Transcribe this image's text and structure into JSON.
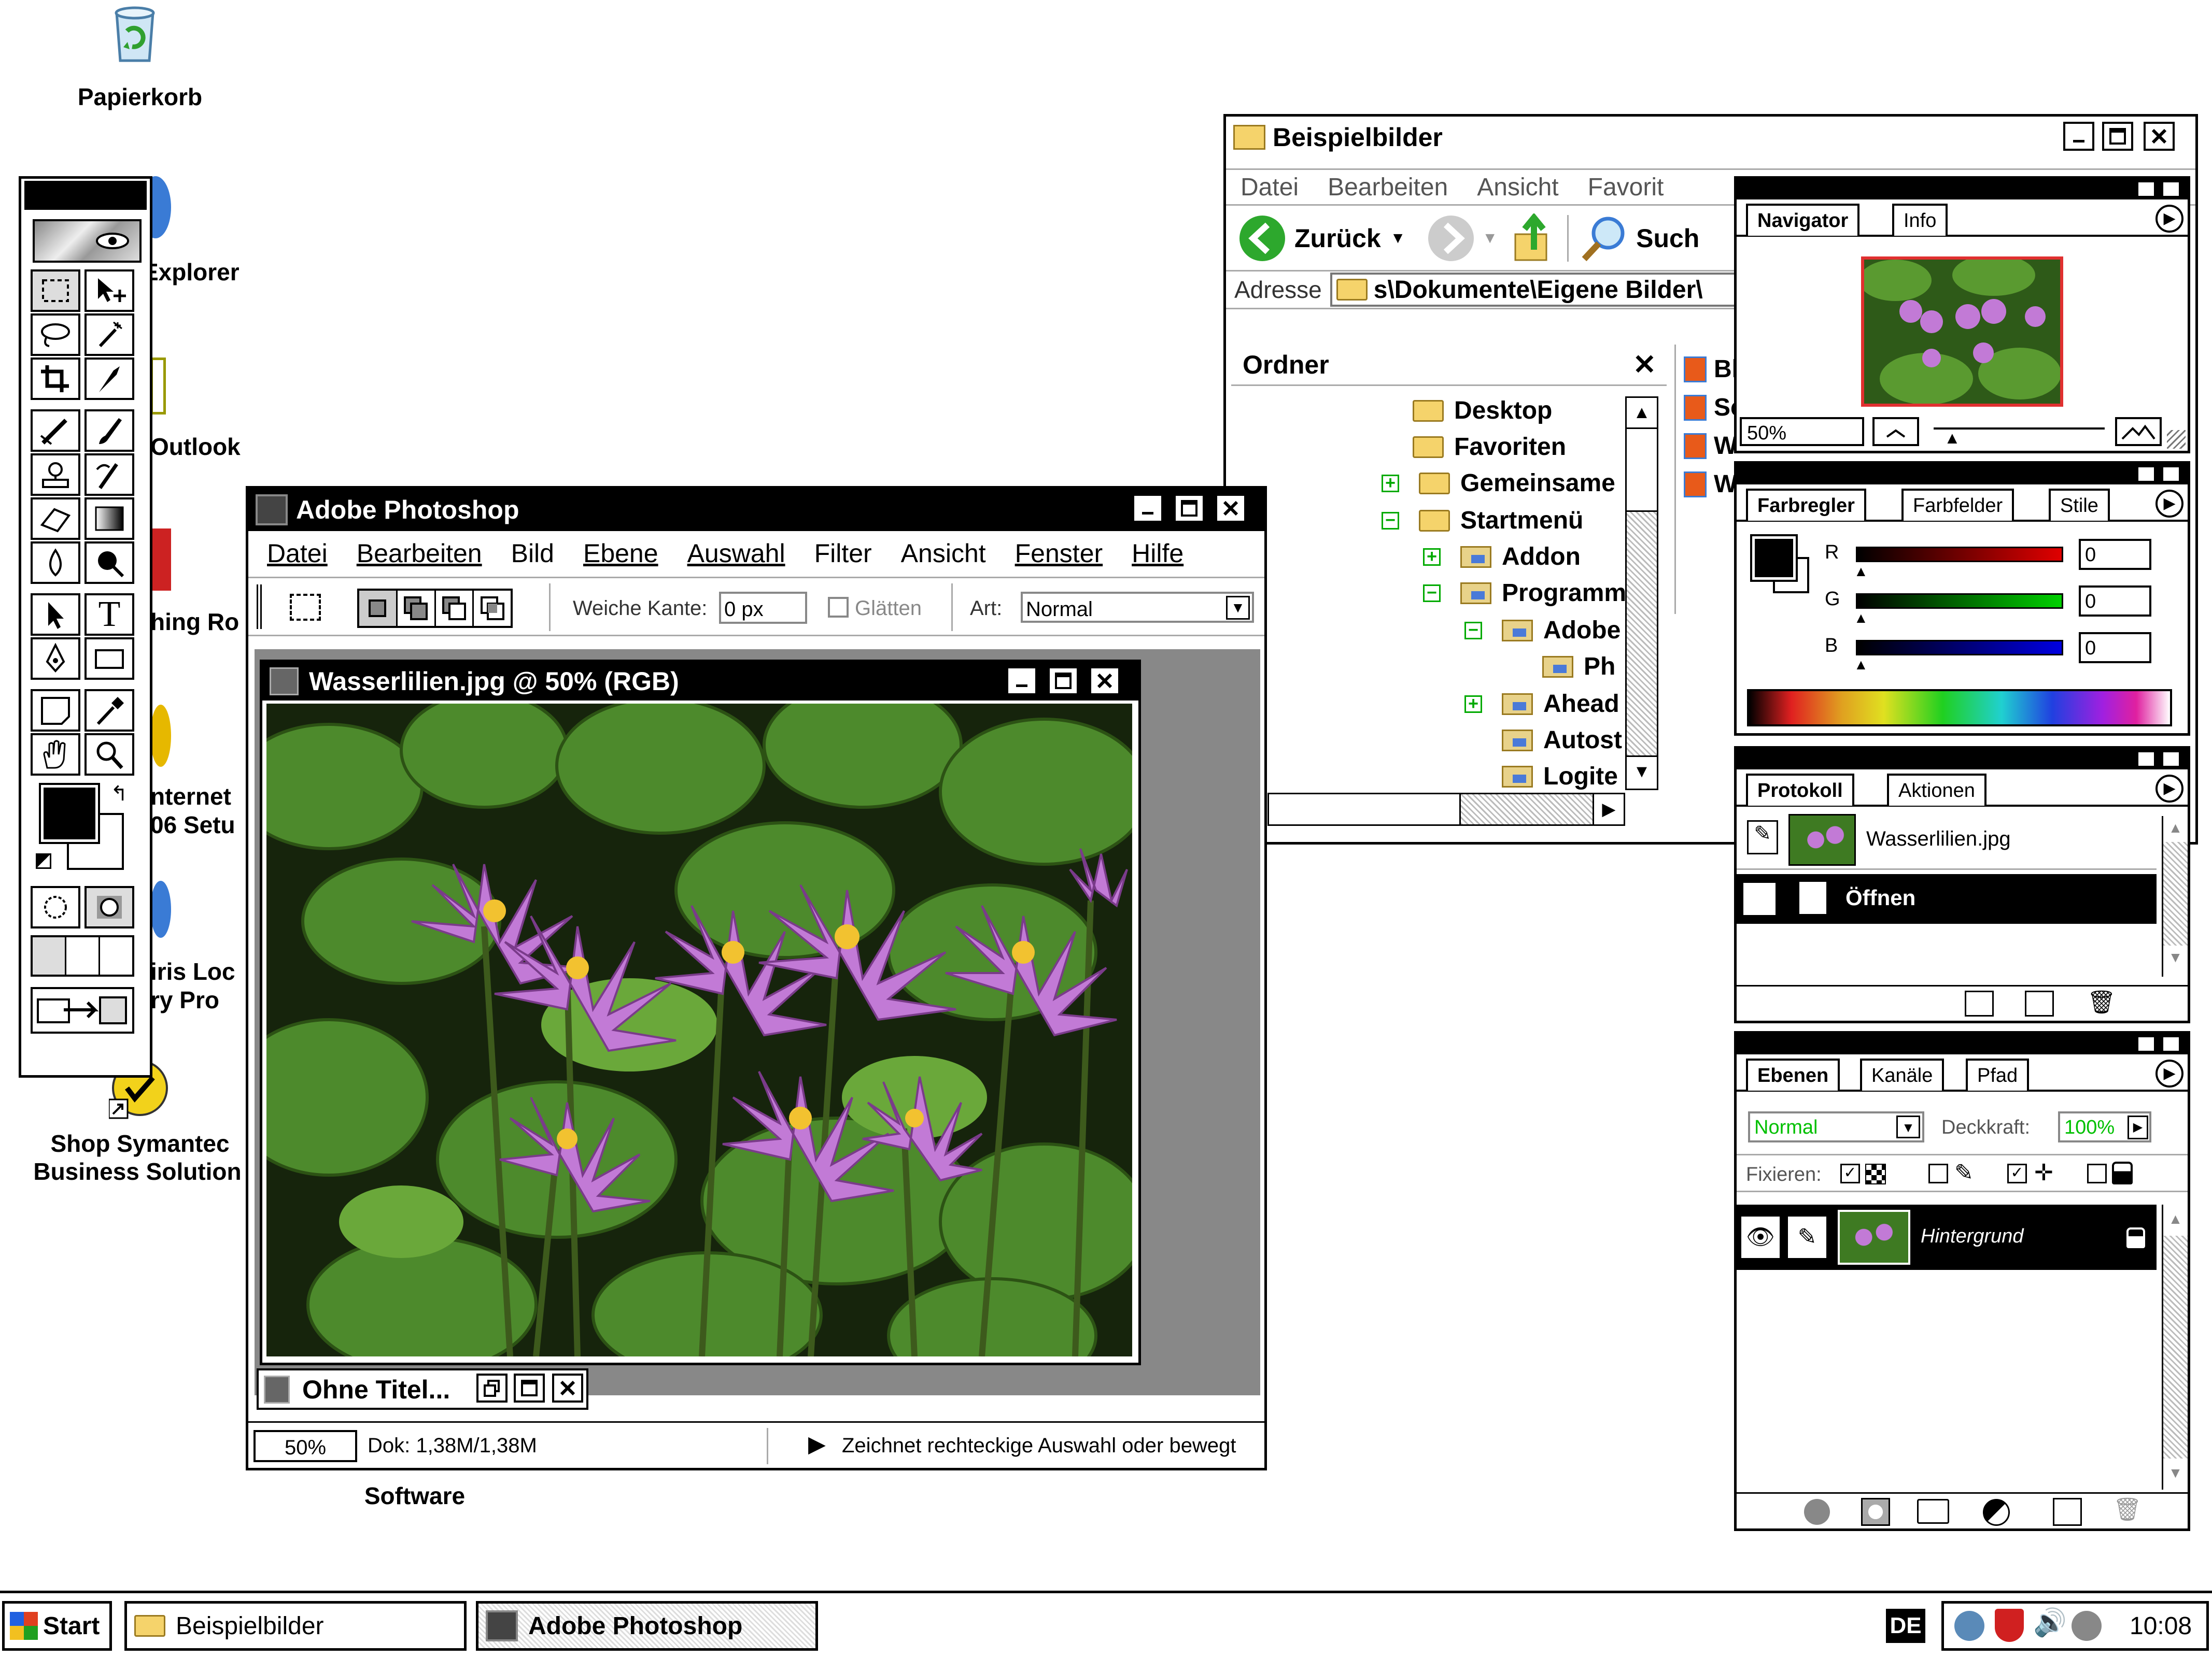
{
  "desktop": {
    "icons": [
      {
        "label": "Papierkorb"
      },
      {
        "label": "Explorer"
      },
      {
        "label": "Outlook"
      },
      {
        "label": "hing Ro"
      },
      {
        "label": "nternet"
      },
      {
        "label": "06 Setu"
      },
      {
        "label": "iris Loc"
      },
      {
        "label": "ry Pro"
      },
      {
        "label": "Shop Symantec"
      },
      {
        "label": "Business Solution"
      },
      {
        "label": "Software"
      }
    ]
  },
  "explorer": {
    "title": "Beispielbilder",
    "menu": [
      "Datei",
      "Bearbeiten",
      "Ansicht",
      "Favorit"
    ],
    "back_label": "Zurück",
    "search_label": "Such",
    "address_label": "Adresse",
    "address_value": "s\\Dokumente\\Eigene Bilder\\",
    "folders_title": "Ordner",
    "tree": [
      {
        "label": "Desktop",
        "toggle": ""
      },
      {
        "label": "Favoriten",
        "toggle": ""
      },
      {
        "label": "Gemeinsame",
        "toggle": "+"
      },
      {
        "label": "Startmenü",
        "toggle": "−"
      },
      {
        "label": "Addon",
        "toggle": "+"
      },
      {
        "label": "Programm",
        "toggle": "−"
      },
      {
        "label": "Adobe",
        "toggle": "−"
      },
      {
        "label": "Ph",
        "toggle": ""
      },
      {
        "label": "Ahead",
        "toggle": "+"
      },
      {
        "label": "Autost",
        "toggle": ""
      },
      {
        "label": "Logite",
        "toggle": ""
      }
    ],
    "files": [
      "Bl",
      "Sc",
      "W",
      "W"
    ]
  },
  "photoshop": {
    "title": "Adobe Photoshop",
    "menu": [
      "Datei",
      "Bearbeiten",
      "Bild",
      "Ebene",
      "Auswahl",
      "Filter",
      "Ansicht",
      "Fenster",
      "Hilfe"
    ],
    "options": {
      "feather_label": "Weiche Kante:",
      "feather_value": "0 px",
      "antialias_label": "Glätten",
      "style_label": "Art:",
      "style_value": "Normal"
    },
    "document": {
      "title": "Wasserlilien.jpg @ 50% (RGB)"
    },
    "minimized_doc": {
      "title": "Ohne Titel..."
    },
    "status": {
      "zoom": "50%",
      "doc": "Dok: 1,38M/1,38M",
      "hint": "Zeichnet rechteckige Auswahl oder bewegt"
    }
  },
  "navigator": {
    "tabs": [
      "Navigator",
      "Info"
    ],
    "zoom": "50%"
  },
  "color": {
    "tabs": [
      "Farbregler",
      "Farbfelder",
      "Stile"
    ],
    "channels": [
      {
        "name": "R",
        "value": "0",
        "color": "#cc0000"
      },
      {
        "name": "G",
        "value": "0",
        "color": "#00cc00"
      },
      {
        "name": "B",
        "value": "0",
        "color": "#0000cc"
      }
    ]
  },
  "history": {
    "tabs": [
      "Protokoll",
      "Aktionen"
    ],
    "snapshot": "Wasserlilien.jpg",
    "items": [
      "Öffnen"
    ]
  },
  "layers": {
    "tabs": [
      "Ebenen",
      "Kanäle",
      "Pfad"
    ],
    "mode": "Normal",
    "opacity_label": "Deckkraft:",
    "opacity": "100%",
    "lock_label": "Fixieren:",
    "layer_name": "Hintergrund"
  },
  "taskbar": {
    "start": "Start",
    "buttons": [
      "Beispielbilder",
      "Adobe Photoshop"
    ],
    "lang": "DE",
    "clock": "10:08"
  }
}
